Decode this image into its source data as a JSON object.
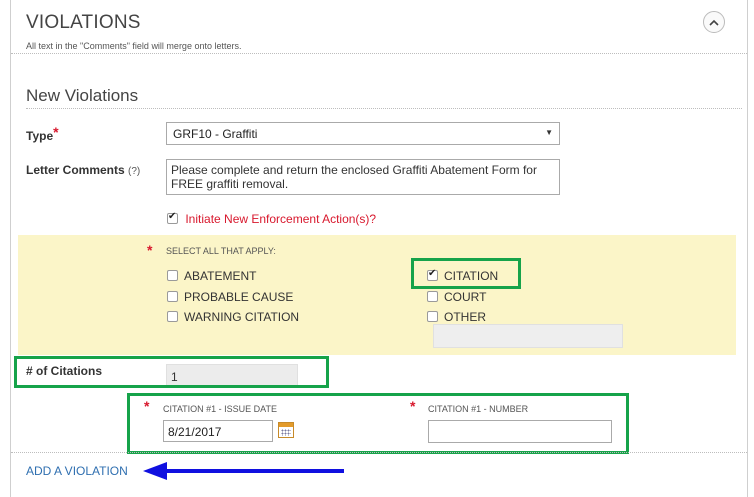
{
  "section": {
    "title": "VIOLATIONS",
    "note": "All text in the \"Comments\" field will merge onto letters."
  },
  "new_violations": {
    "title": "New Violations",
    "type": {
      "label": "Type",
      "required_marker": "*",
      "value": "GRF10 - Graffiti"
    },
    "letter_comments": {
      "label": "Letter Comments",
      "help": "(?)",
      "value": "Please complete and return the enclosed Graffiti Abatement Form for FREE graffiti removal."
    },
    "initiate": {
      "label": "Initiate New Enforcement Action(s)?",
      "checked": true
    }
  },
  "actions": {
    "required_marker": "*",
    "caption": "SELECT ALL THAT APPLY:",
    "options": [
      {
        "label": "ABATEMENT",
        "checked": false
      },
      {
        "label": "PROBABLE CAUSE",
        "checked": false
      },
      {
        "label": "WARNING CITATION",
        "checked": false
      },
      {
        "label": "CITATION",
        "checked": true
      },
      {
        "label": "COURT",
        "checked": false
      },
      {
        "label": "OTHER",
        "checked": false
      }
    ]
  },
  "num_citations": {
    "label": "# of Citations",
    "value": "1"
  },
  "citation": {
    "required_marker": "*",
    "issue_date": {
      "label": "CITATION #1 - ISSUE DATE",
      "value": "8/21/2017"
    },
    "number": {
      "label": "CITATION #1 - NUMBER",
      "value": ""
    }
  },
  "add_violation": {
    "label": "ADD A VIOLATION"
  },
  "colors": {
    "highlight_border": "#16a34a",
    "arrow": "#1010e0",
    "required": "#d8182d",
    "link": "#2f6fb0",
    "panel": "#fbf5c8"
  }
}
